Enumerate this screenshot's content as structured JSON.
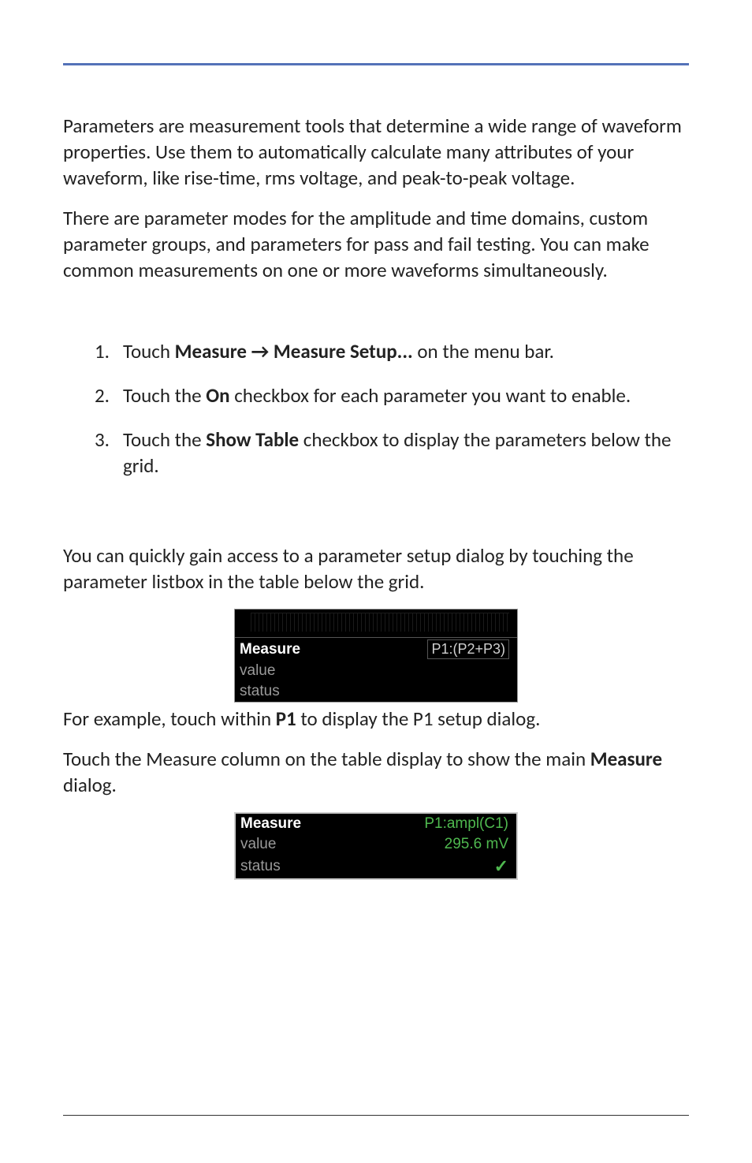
{
  "para1": "Parameters are measurement tools that determine a wide range of waveform properties. Use them to automatically calculate many attributes of your waveform, like rise-time, rms voltage, and peak-to-peak voltage.",
  "para2": "There are parameter modes for the amplitude and time domains, custom parameter groups, and parameters for pass and fail testing. You can make common measurements on one or more waveforms simultaneously.",
  "steps": {
    "n1": "1.",
    "n2": "2.",
    "n3": "3.",
    "s1_pre": "Touch ",
    "s1_bold": "Measure → Measure Setup...",
    "s1_post": " on the menu bar.",
    "s2_pre": "Touch the ",
    "s2_bold": "On",
    "s2_post": " checkbox for each parameter you want to enable.",
    "s3_pre": "Touch the ",
    "s3_bold": "Show Table",
    "s3_post": " checkbox to display the parameters below the grid."
  },
  "para3": "You can quickly gain access to a parameter setup dialog by touching the parameter listbox in the table below the grid.",
  "screenshot1": {
    "measure": "Measure",
    "p1": "P1:(P2+P3)",
    "value": "value",
    "status": "status"
  },
  "para4_pre": "For example, touch within ",
  "para4_bold": "P1",
  "para4_post": " to display the P1 setup dialog.",
  "para5_pre": "Touch the Measure column on the table display to show the main ",
  "para5_bold": "Measure",
  "para5_post": " dialog.",
  "screenshot2": {
    "measure": "Measure",
    "p1": "P1:ampl(C1)",
    "value": "value",
    "value_val": "295.6 mV",
    "status": "status",
    "check": "✓"
  }
}
